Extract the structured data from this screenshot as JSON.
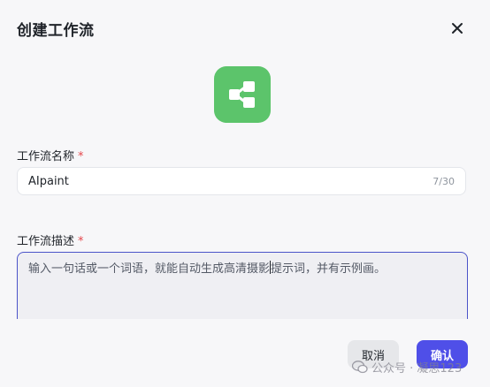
{
  "dialog": {
    "title": "创建工作流",
    "close_icon": "close-icon",
    "app_icon": "workflow-share-icon",
    "accent_color": "#5cc46b"
  },
  "name_field": {
    "label": "工作流名称",
    "required_mark": "*",
    "value": "AIpaint",
    "counter": "7/30"
  },
  "description_field": {
    "label": "工作流描述",
    "required_mark": "*",
    "value_before_caret": "输入一句话或一个词语，就能自动生成高清摄影",
    "value_after_caret": "提示词，并有示例画。"
  },
  "buttons": {
    "cancel_label": "取消",
    "confirm_label": "确认",
    "confirm_color": "#4f4fe8"
  },
  "watermark": {
    "text": "公众号 · 凝思123"
  }
}
